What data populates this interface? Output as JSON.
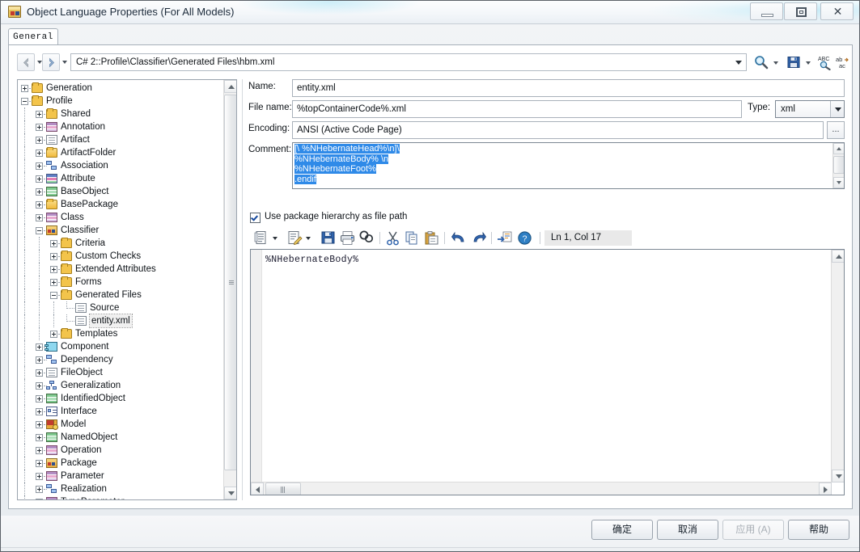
{
  "window": {
    "title": "Object Language Properties (For All Models)",
    "icon": "package-icon",
    "minimize_label": "",
    "maximize_label": "",
    "close_label": "✕"
  },
  "tabs": [
    {
      "label": "General",
      "active": true
    }
  ],
  "navbar": {
    "back_label": "←",
    "forward_label": "→",
    "path": "C# 2::Profile\\Classifier\\Generated Files\\hbm.xml",
    "icons": [
      "search-icon",
      "save-icon",
      "spellcheck-icon",
      "replace-icon"
    ]
  },
  "tree": {
    "items": [
      {
        "label": "Generation",
        "indent": 0,
        "expander": "plus",
        "icon": "folder"
      },
      {
        "label": "Profile",
        "indent": 0,
        "expander": "minus",
        "icon": "folder"
      },
      {
        "label": "Shared",
        "indent": 1,
        "expander": "plus",
        "icon": "folder"
      },
      {
        "label": "Annotation",
        "indent": 1,
        "expander": "plus",
        "icon": "grid3"
      },
      {
        "label": "Artifact",
        "indent": 1,
        "expander": "plus",
        "icon": "doc"
      },
      {
        "label": "ArtifactFolder",
        "indent": 1,
        "expander": "plus",
        "icon": "folder-open"
      },
      {
        "label": "Association",
        "indent": 1,
        "expander": "plus",
        "icon": "assoc"
      },
      {
        "label": "Attribute",
        "indent": 1,
        "expander": "plus",
        "icon": "grid"
      },
      {
        "label": "BaseObject",
        "indent": 1,
        "expander": "plus",
        "icon": "grid2"
      },
      {
        "label": "BasePackage",
        "indent": 1,
        "expander": "plus",
        "icon": "folder-open"
      },
      {
        "label": "Class",
        "indent": 1,
        "expander": "plus",
        "icon": "grid3"
      },
      {
        "label": "Classifier",
        "indent": 1,
        "expander": "minus",
        "icon": "pkg"
      },
      {
        "label": "Criteria",
        "indent": 2,
        "expander": "plus",
        "icon": "folder"
      },
      {
        "label": "Custom Checks",
        "indent": 2,
        "expander": "plus",
        "icon": "folder"
      },
      {
        "label": "Extended Attributes",
        "indent": 2,
        "expander": "plus",
        "icon": "folder"
      },
      {
        "label": "Forms",
        "indent": 2,
        "expander": "plus",
        "icon": "folder"
      },
      {
        "label": "Generated Files",
        "indent": 2,
        "expander": "minus",
        "icon": "folder"
      },
      {
        "label": "Source",
        "indent": 3,
        "expander": "none",
        "icon": "doc"
      },
      {
        "label": "entity.xml",
        "indent": 3,
        "expander": "none",
        "icon": "doc",
        "selected": true
      },
      {
        "label": "Templates",
        "indent": 2,
        "expander": "plus",
        "icon": "folder"
      },
      {
        "label": "Component",
        "indent": 1,
        "expander": "plus",
        "icon": "comp"
      },
      {
        "label": "Dependency",
        "indent": 1,
        "expander": "plus",
        "icon": "assoc"
      },
      {
        "label": "FileObject",
        "indent": 1,
        "expander": "plus",
        "icon": "doc"
      },
      {
        "label": "Generalization",
        "indent": 1,
        "expander": "plus",
        "icon": "gen"
      },
      {
        "label": "IdentifiedObject",
        "indent": 1,
        "expander": "plus",
        "icon": "grid2"
      },
      {
        "label": "Interface",
        "indent": 1,
        "expander": "plus",
        "icon": "iface"
      },
      {
        "label": "Model",
        "indent": 1,
        "expander": "plus",
        "icon": "model"
      },
      {
        "label": "NamedObject",
        "indent": 1,
        "expander": "plus",
        "icon": "grid2"
      },
      {
        "label": "Operation",
        "indent": 1,
        "expander": "plus",
        "icon": "grid3"
      },
      {
        "label": "Package",
        "indent": 1,
        "expander": "plus",
        "icon": "pkg"
      },
      {
        "label": "Parameter",
        "indent": 1,
        "expander": "plus",
        "icon": "grid3"
      },
      {
        "label": "Realization",
        "indent": 1,
        "expander": "plus",
        "icon": "assoc"
      },
      {
        "label": "TypeParameter",
        "indent": 1,
        "expander": "plus",
        "icon": "grid3"
      }
    ]
  },
  "form": {
    "name_label": "Name:",
    "name_value": "entity.xml",
    "filename_label": "File name:",
    "filename_value": "%topContainerCode%.xml",
    "type_label": "Type:",
    "type_value": "xml",
    "encoding_label": "Encoding:",
    "encoding_value": "ANSI (Active Code Page)",
    "encoding_browse_label": "...",
    "comment_label": "Comment:",
    "comment_lines": [
      "[\\ %NHebernateHead%\\n]\\",
      "%NHebernateBody% \\n",
      "%NHebernateFoot%",
      ".endif"
    ],
    "checkbox_label": "Use package hierarchy as file path",
    "checkbox_checked": true
  },
  "editor_toolbar": {
    "icons": [
      "new-document-icon",
      "open-template-icon",
      "save-icon",
      "print-icon",
      "find-icon",
      "cut-icon",
      "copy-icon",
      "paste-icon",
      "undo-icon",
      "redo-icon",
      "insert-macro-icon",
      "help-icon"
    ],
    "position_label": "Ln 1, Col 17"
  },
  "editor": {
    "content": "%NHebernateBody%"
  },
  "buttons": {
    "ok": "确定",
    "cancel": "取消",
    "apply": "应用 (A)",
    "help": "帮助",
    "apply_disabled": true
  },
  "colors": {
    "selection": "#2f8ae8",
    "folder": "#f3c44b",
    "window_bg": "#eef1f4"
  }
}
